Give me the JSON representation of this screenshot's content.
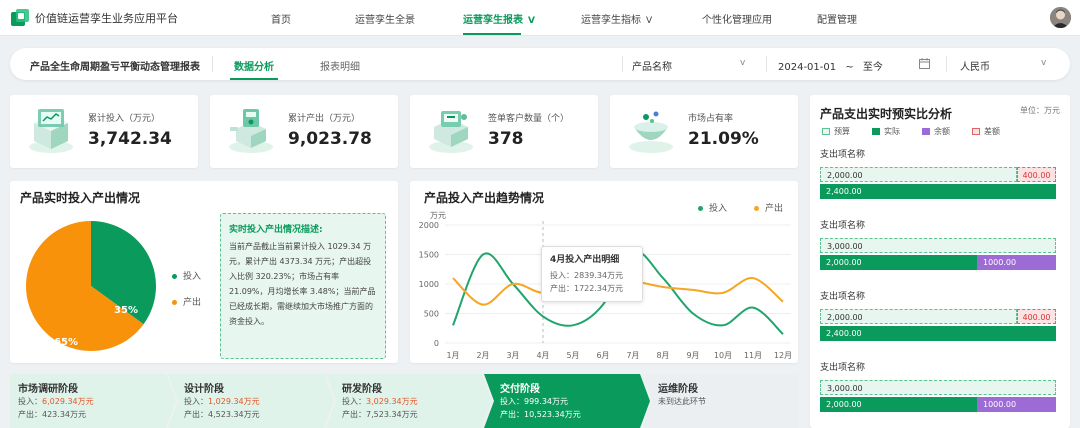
{
  "header": {
    "app_title": "价值链运营孪生业务应用平台",
    "nav": [
      {
        "label": "首页"
      },
      {
        "label": "运营孪生全景"
      },
      {
        "label": "运营孪生报表"
      },
      {
        "label": "运营孪生指标"
      },
      {
        "label": "个性化管理应用"
      },
      {
        "label": "配置管理"
      }
    ],
    "chevron": "V"
  },
  "filterbar": {
    "title": "产品全生命周期盈亏平衡动态管理报表",
    "tabs": [
      {
        "label": "数据分析"
      },
      {
        "label": "报表明细"
      }
    ],
    "product_placeholder": "产品名称",
    "date_start": "2024-01-01",
    "date_sep": "~",
    "date_end": "至今",
    "currency": "人民币",
    "chevron": "v"
  },
  "kpis": [
    {
      "label": "累计投入（万元）",
      "value": "3,742.34",
      "icon": "server-icon"
    },
    {
      "label": "累计产出（万元）",
      "value": "9,023.78",
      "icon": "output-machine-icon"
    },
    {
      "label": "签单客户数量（个）",
      "value": "378",
      "icon": "customer-device-icon"
    },
    {
      "label": "市场占有率",
      "value": "21.09%",
      "icon": "market-bowl-icon"
    }
  ],
  "pie": {
    "title": "产品实时投入产出情况",
    "slices": [
      {
        "name": "投入",
        "value": 35,
        "label": "35%",
        "color": "#0a9a5c"
      },
      {
        "name": "产出",
        "value": 65,
        "label": "65%",
        "color": "#f7920a"
      }
    ],
    "desc_title": "实时投入产出情况描述:",
    "desc_text": "当前产品截止当前累计投入 1029.34 万元，累计产出 4373.34 万元；产出超投入比例 320.23%；市场占有率21.09%，月均增长率 3.48%；当前产品已经成长期，需继续加大市场推广方面的资金投入。"
  },
  "chart_data": {
    "type": "line",
    "title": "产品投入产出趋势情况",
    "ylabel": "万元",
    "xlabel": "",
    "categories": [
      "1月",
      "2月",
      "3月",
      "4月",
      "5月",
      "6月",
      "7月",
      "8月",
      "9月",
      "10月",
      "11月",
      "12月"
    ],
    "ylim": [
      0,
      2000
    ],
    "yticks": [
      0,
      500,
      1000,
      1500,
      2000
    ],
    "grid": true,
    "legend": "top-right",
    "series": [
      {
        "name": "投入",
        "color": "#21a56b",
        "values": [
          300,
          1500,
          1000,
          450,
          300,
          650,
          1550,
          1100,
          500,
          300,
          600,
          150
        ]
      },
      {
        "name": "产出",
        "color": "#f5a623",
        "values": [
          1100,
          650,
          1000,
          850,
          1000,
          1100,
          1050,
          950,
          900,
          850,
          1100,
          700
        ]
      }
    ],
    "tooltip": {
      "title": "4月投入产出明细",
      "lines": [
        {
          "label": "投入：",
          "value": "2839.34万元"
        },
        {
          "label": "产出：",
          "value": "1722.34万元"
        }
      ]
    }
  },
  "budget": {
    "title": "产品支出实时预实比分析",
    "unit": "单位：万元",
    "legend": [
      {
        "label": "预算",
        "color": "#e7f6ee"
      },
      {
        "label": "实际",
        "color": "#0a9a5c"
      },
      {
        "label": "余额",
        "color": "#9d6bd6"
      },
      {
        "label": "差额",
        "color": "#fbe3e3"
      }
    ],
    "items": [
      {
        "label": "支出项名称",
        "budget": 2000,
        "budget_label": "2,000.00",
        "extra_label": "400.00",
        "extra_type": "diff",
        "actual": 2400,
        "actual_label": "2,400.00"
      },
      {
        "label": "支出项名称",
        "budget": 3000,
        "budget_label": "3,000.00",
        "actual": 2000,
        "actual_label": "2,000.00",
        "extra_label": "1000.00",
        "extra_type": "remain"
      },
      {
        "label": "支出项名称",
        "budget": 2000,
        "budget_label": "2,000.00",
        "extra_label": "400.00",
        "extra_type": "diff",
        "actual": 2400,
        "actual_label": "2,400.00"
      },
      {
        "label": "支出项名称",
        "budget": 3000,
        "budget_label": "3,000.00",
        "actual": 2000,
        "actual_label": "2,000.00",
        "extra_label": "1000.00",
        "extra_type": "remain"
      }
    ]
  },
  "stages": [
    {
      "name": "市场调研阶段",
      "in_label": "投入：",
      "in_value": "6,029.34万元",
      "out_label": "产出：",
      "out_value": "423.34万元"
    },
    {
      "name": "设计阶段",
      "in_label": "投入：",
      "in_value": "1,029.34万元",
      "out_label": "产出：",
      "out_value": "4,523.34万元"
    },
    {
      "name": "研发阶段",
      "in_label": "投入：",
      "in_value": "3,029.34万元",
      "out_label": "产出：",
      "out_value": "7,523.34万元"
    },
    {
      "name": "交付阶段",
      "in_label": "投入：",
      "in_value": "999.34万元",
      "out_label": "产出：",
      "out_value": "10,523.34万元",
      "active": true
    },
    {
      "name": "运维阶段",
      "note": "未到达此环节"
    }
  ]
}
